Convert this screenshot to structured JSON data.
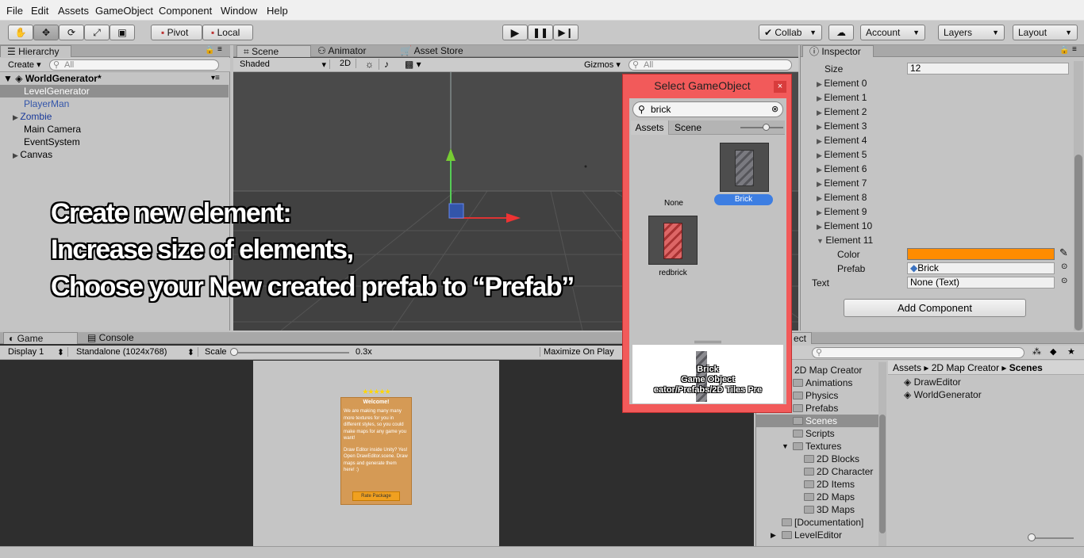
{
  "menu": [
    "File",
    "Edit",
    "Assets",
    "GameObject",
    "Component",
    "Window",
    "Help"
  ],
  "toolbar": {
    "pivot": "Pivot",
    "local": "Local",
    "collab": "Collab",
    "account": "Account",
    "layers": "Layers",
    "layout": "Layout"
  },
  "hierarchy": {
    "tab": "Hierarchy",
    "create": "Create",
    "search_placeholder": "All",
    "scene": "WorldGenerator*",
    "items": [
      "LevelGenerator",
      "PlayerMan",
      "Zombie",
      "Main Camera",
      "EventSystem",
      "Canvas"
    ]
  },
  "scene_view": {
    "tabs": [
      "Scene",
      "Animator",
      "Asset Store"
    ],
    "shading": "Shaded",
    "mode_2d": "2D",
    "gizmos": "Gizmos",
    "search_placeholder": "All"
  },
  "overlay_text": {
    "line1": "Create new element:",
    "line2": "Increase size of elements,",
    "line3": "Choose your New created prefab to “Prefab”"
  },
  "select_dialog": {
    "title": "Select GameObject",
    "search_value": "brick",
    "tabs": [
      "Assets",
      "Scene"
    ],
    "items": [
      "None",
      "Brick",
      "redbrick"
    ],
    "selected": "Brick",
    "preview_name": "Brick",
    "preview_type": "Game Object",
    "preview_path": "eator/Prefabs/2D Tiles Pre",
    "colors": {
      "frame": "#f25a5a",
      "selection": "#3d7ee2"
    }
  },
  "inspector": {
    "tab": "Inspector",
    "size_label": "Size",
    "size_value": "12",
    "elements": [
      "Element 0",
      "Element 1",
      "Element 2",
      "Element 3",
      "Element 4",
      "Element 5",
      "Element 6",
      "Element 7",
      "Element 8",
      "Element 9",
      "Element 10",
      "Element 11"
    ],
    "color_label": "Color",
    "color_value": "#ff8c00",
    "prefab_label": "Prefab",
    "prefab_value": "Brick",
    "text_label": "Text",
    "text_value": "None (Text)",
    "add_component": "Add Component"
  },
  "game_view": {
    "tabs": [
      "Game",
      "Console"
    ],
    "display": "Display 1",
    "resolution": "Standalone (1024x768)",
    "scale_label": "Scale",
    "scale_value": "0.3x",
    "maximize": "Maximize On Play",
    "card_stars": "★★★★★",
    "card_title": "Welcome!",
    "card_body1": "We are making many many more textures for you in different styles, so you could make maps for any game you want!",
    "card_body2": "Draw Editor inside Unity? Yes! Open DrawEditor.scene. Draw maps and generate them here! :)",
    "card_button": "Rate Package"
  },
  "project": {
    "tab_partial": "ect",
    "folders": [
      {
        "name": "2D Map Creator",
        "indent": 0
      },
      {
        "name": "Animations",
        "indent": 1
      },
      {
        "name": "Physics",
        "indent": 1
      },
      {
        "name": "Prefabs",
        "indent": 1
      },
      {
        "name": "Scenes",
        "indent": 1,
        "selected": true
      },
      {
        "name": "Scripts",
        "indent": 1
      },
      {
        "name": "Textures",
        "indent": 1
      },
      {
        "name": "2D Blocks",
        "indent": 2
      },
      {
        "name": "2D Character",
        "indent": 2
      },
      {
        "name": "2D Items",
        "indent": 2
      },
      {
        "name": "2D Maps",
        "indent": 2
      },
      {
        "name": "3D Maps",
        "indent": 2
      },
      {
        "name": "[Documentation]",
        "indent": 0
      },
      {
        "name": "LevelEditor",
        "indent": 0
      }
    ],
    "breadcrumb": [
      "Assets",
      "2D Map Creator",
      "Scenes"
    ],
    "files": [
      "DrawEditor",
      "WorldGenerator"
    ]
  }
}
